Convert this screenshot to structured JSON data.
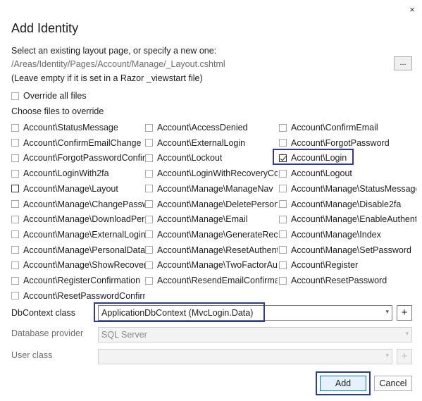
{
  "dialog": {
    "title": "Add Identity",
    "close_icon": "×"
  },
  "layout": {
    "instruction": "Select an existing layout page, or specify a new one:",
    "path": "/Areas/Identity/Pages/Account/Manage/_Layout.cshtml",
    "hint": "(Leave empty if it is set in a Razor _viewstart file)",
    "browse_label": "..."
  },
  "override_all": {
    "label": "Override all files",
    "checked": false
  },
  "choose_files_label": "Choose files to override",
  "files": [
    [
      {
        "label": "Account\\StatusMessage",
        "checked": false
      },
      {
        "label": "Account\\AccessDenied",
        "checked": false
      },
      {
        "label": "Account\\ConfirmEmail",
        "checked": false
      }
    ],
    [
      {
        "label": "Account\\ConfirmEmailChange",
        "checked": false
      },
      {
        "label": "Account\\ExternalLogin",
        "checked": false
      },
      {
        "label": "Account\\ForgotPassword",
        "checked": false
      }
    ],
    [
      {
        "label": "Account\\ForgotPasswordConfirmation",
        "checked": false
      },
      {
        "label": "Account\\Lockout",
        "checked": false
      },
      {
        "label": "Account\\Login",
        "checked": true
      }
    ],
    [
      {
        "label": "Account\\LoginWith2fa",
        "checked": false
      },
      {
        "label": "Account\\LoginWithRecoveryCode",
        "checked": false
      },
      {
        "label": "Account\\Logout",
        "checked": false
      }
    ],
    [
      {
        "label": "Account\\Manage\\Layout",
        "checked": false
      },
      {
        "label": "Account\\Manage\\ManageNav",
        "checked": false
      },
      {
        "label": "Account\\Manage\\StatusMessage",
        "checked": false
      }
    ],
    [
      {
        "label": "Account\\Manage\\ChangePassword",
        "checked": false
      },
      {
        "label": "Account\\Manage\\DeletePersonalData",
        "checked": false
      },
      {
        "label": "Account\\Manage\\Disable2fa",
        "checked": false
      }
    ],
    [
      {
        "label": "Account\\Manage\\DownloadPersonalData",
        "checked": false
      },
      {
        "label": "Account\\Manage\\Email",
        "checked": false
      },
      {
        "label": "Account\\Manage\\EnableAuthenticator",
        "checked": false
      }
    ],
    [
      {
        "label": "Account\\Manage\\ExternalLogins",
        "checked": false
      },
      {
        "label": "Account\\Manage\\GenerateRecoveryCodes",
        "checked": false
      },
      {
        "label": "Account\\Manage\\Index",
        "checked": false
      }
    ],
    [
      {
        "label": "Account\\Manage\\PersonalData",
        "checked": false
      },
      {
        "label": "Account\\Manage\\ResetAuthenticator",
        "checked": false
      },
      {
        "label": "Account\\Manage\\SetPassword",
        "checked": false
      }
    ],
    [
      {
        "label": "Account\\Manage\\ShowRecoveryCodes",
        "checked": false
      },
      {
        "label": "Account\\Manage\\TwoFactorAuthentication",
        "checked": false
      },
      {
        "label": "Account\\Register",
        "checked": false
      }
    ],
    [
      {
        "label": "Account\\RegisterConfirmation",
        "checked": false
      },
      {
        "label": "Account\\ResendEmailConfirmation",
        "checked": false
      },
      {
        "label": "Account\\ResetPassword",
        "checked": false
      }
    ],
    [
      {
        "label": "Account\\ResetPasswordConfirmation",
        "checked": false
      }
    ]
  ],
  "dbcontext": {
    "label": "DbContext class",
    "value": "ApplicationDbContext (MvcLogin.Data)",
    "add_label": "+"
  },
  "database_provider": {
    "label": "Database provider",
    "value": "SQL Server"
  },
  "user_class": {
    "label": "User class",
    "value": "",
    "add_label": "+"
  },
  "buttons": {
    "add": "Add",
    "cancel": "Cancel"
  }
}
